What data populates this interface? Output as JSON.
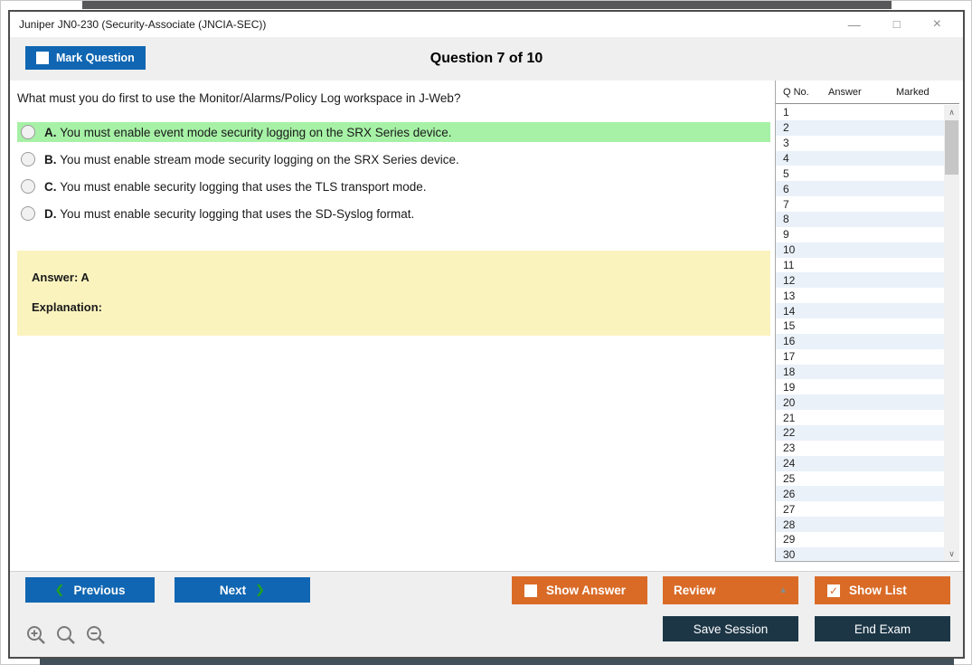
{
  "window": {
    "title": "Juniper JN0-230 (Security-Associate (JNCIA-SEC))"
  },
  "icons": {
    "minimize": "—",
    "maximize": "□",
    "close": "×",
    "check": "✓",
    "prev_chevron": "❮",
    "next_chevron": "❯",
    "dropdown_up_triangle": "▲",
    "scroll_up": "∧",
    "scroll_down": "∨"
  },
  "header": {
    "mark_question_label": "Mark Question",
    "question_counter": "Question 7 of 10"
  },
  "question": {
    "text": "What must you do first to use the Monitor/Alarms/Policy Log workspace in J-Web?",
    "options": [
      {
        "letter": "A.",
        "text": "You must enable event mode security logging on the SRX Series device.",
        "highlighted": true
      },
      {
        "letter": "B.",
        "text": "You must enable stream mode security logging on the SRX Series device.",
        "highlighted": false
      },
      {
        "letter": "C.",
        "text": "You must enable security logging that uses the TLS transport mode.",
        "highlighted": false
      },
      {
        "letter": "D.",
        "text": "You must enable security logging that uses the SD-Syslog format.",
        "highlighted": false
      }
    ],
    "answer_label": "Answer: A",
    "explanation_label": "Explanation:"
  },
  "question_list": {
    "columns": [
      "Q No.",
      "Answer",
      "Marked"
    ],
    "rows": [
      "1",
      "2",
      "3",
      "4",
      "5",
      "6",
      "7",
      "8",
      "9",
      "10",
      "11",
      "12",
      "13",
      "14",
      "15",
      "16",
      "17",
      "18",
      "19",
      "20",
      "21",
      "22",
      "23",
      "24",
      "25",
      "26",
      "27",
      "28",
      "29",
      "30"
    ]
  },
  "footer": {
    "previous_label": "Previous",
    "next_label": "Next",
    "show_answer_label": "Show Answer",
    "review_label": "Review",
    "show_list_label": "Show List",
    "save_session_label": "Save Session",
    "end_exam_label": "End Exam"
  },
  "colors": {
    "accent_blue": "#1066b2",
    "accent_orange": "#d96b27",
    "navy": "#1c3646",
    "highlight_green": "#a6f1a6",
    "answer_yellow": "#faf3be"
  }
}
